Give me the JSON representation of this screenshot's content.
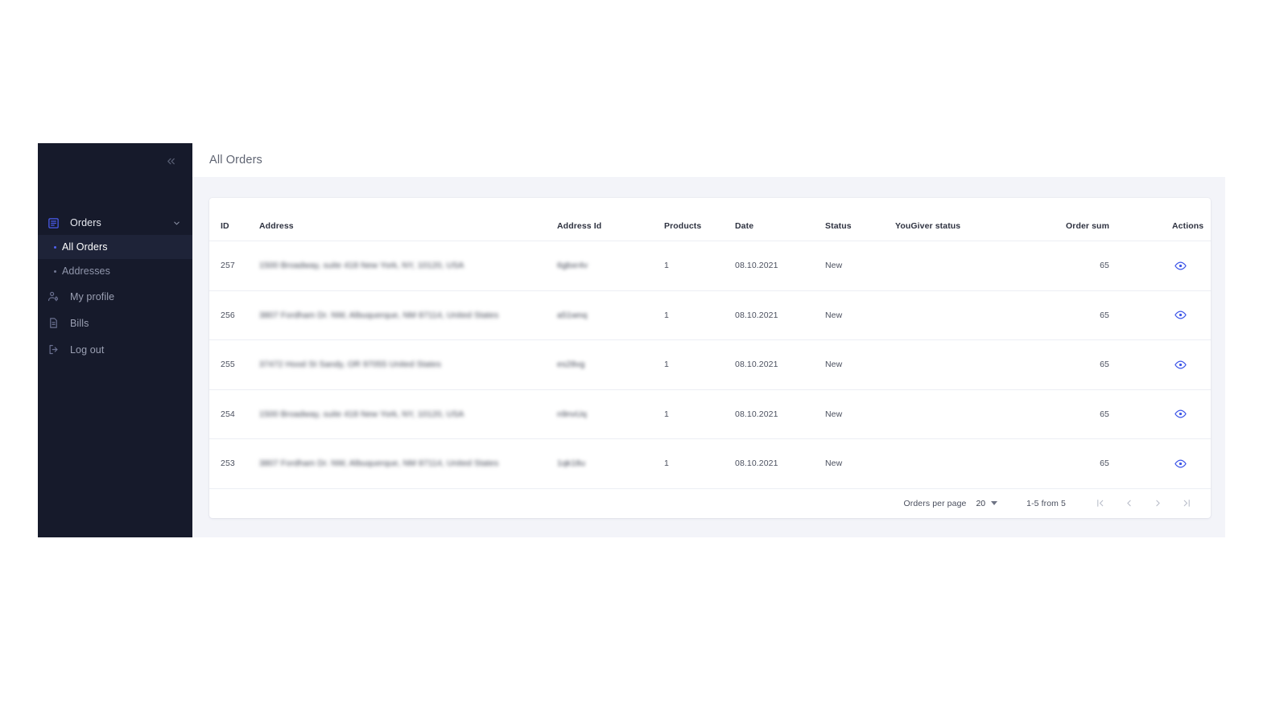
{
  "sidebar": {
    "collapse_icon": "chevrons-left-icon",
    "nav": [
      {
        "id": "orders",
        "label": "Orders",
        "icon": "orders-list-icon",
        "expanded": true,
        "chevron": "chevron-down-icon",
        "children": [
          {
            "id": "all-orders",
            "label": "All Orders",
            "active": true
          },
          {
            "id": "addresses",
            "label": "Addresses",
            "active": false
          }
        ]
      },
      {
        "id": "my-profile",
        "label": "My profile",
        "icon": "user-settings-icon"
      },
      {
        "id": "bills",
        "label": "Bills",
        "icon": "document-icon"
      },
      {
        "id": "log-out",
        "label": "Log out",
        "icon": "logout-icon"
      }
    ]
  },
  "header": {
    "title": "All Orders"
  },
  "table": {
    "columns": [
      {
        "key": "id",
        "label": "ID"
      },
      {
        "key": "address",
        "label": "Address"
      },
      {
        "key": "address_id",
        "label": "Address Id"
      },
      {
        "key": "products",
        "label": "Products"
      },
      {
        "key": "date",
        "label": "Date"
      },
      {
        "key": "status",
        "label": "Status"
      },
      {
        "key": "yougiver_status",
        "label": "YouGiver status"
      },
      {
        "key": "order_sum",
        "label": "Order sum"
      },
      {
        "key": "actions",
        "label": "Actions"
      }
    ],
    "rows": [
      {
        "id": "257",
        "address": "1500 Broadway, suite 418 New York, NY, 10120, USA",
        "address_id": "6gbxr4v",
        "products": "1",
        "date": "08.10.2021",
        "status": "New",
        "yougiver_status": "",
        "order_sum": "65",
        "action_icon": "eye-icon"
      },
      {
        "id": "256",
        "address": "3807 Fordham Dr. NW, Albuquerque, NM 87114, United States",
        "address_id": "a51wnq",
        "products": "1",
        "date": "08.10.2021",
        "status": "New",
        "yougiver_status": "",
        "order_sum": "65",
        "action_icon": "eye-icon"
      },
      {
        "id": "255",
        "address": "37472 Hood St Sandy, OR 97055 United States",
        "address_id": "es28vg",
        "products": "1",
        "date": "08.10.2021",
        "status": "New",
        "yougiver_status": "",
        "order_sum": "65",
        "action_icon": "eye-icon"
      },
      {
        "id": "254",
        "address": "1500 Broadway, suite 418 New York, NY, 10120, USA",
        "address_id": "n9nvUq",
        "products": "1",
        "date": "08.10.2021",
        "status": "New",
        "yougiver_status": "",
        "order_sum": "65",
        "action_icon": "eye-icon"
      },
      {
        "id": "253",
        "address": "3807 Fordham Dr. NW, Albuquerque, NM 87114, United States",
        "address_id": "1qk18u",
        "products": "1",
        "date": "08.10.2021",
        "status": "New",
        "yougiver_status": "",
        "order_sum": "65",
        "action_icon": "eye-icon"
      }
    ]
  },
  "pagination": {
    "per_page_label": "Orders per page",
    "per_page_value": "20",
    "range_text": "1-5 from 5",
    "buttons": [
      {
        "id": "first",
        "icon": "first-page-icon"
      },
      {
        "id": "prev",
        "icon": "prev-page-icon"
      },
      {
        "id": "next",
        "icon": "next-page-icon"
      },
      {
        "id": "last",
        "icon": "last-page-icon"
      }
    ]
  },
  "colors": {
    "sidebar_bg": "#161a2b",
    "sidebar_active": "#1e2338",
    "accent": "#3b54e8",
    "content_bg": "#f3f4f9",
    "card_bg": "#ffffff"
  }
}
